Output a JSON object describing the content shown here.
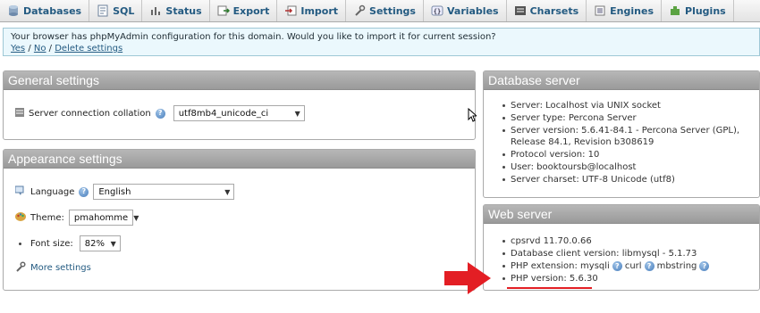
{
  "tabs": [
    {
      "label": "Databases",
      "icon": "databases-icon"
    },
    {
      "label": "SQL",
      "icon": "sql-icon"
    },
    {
      "label": "Status",
      "icon": "status-icon"
    },
    {
      "label": "Export",
      "icon": "export-icon"
    },
    {
      "label": "Import",
      "icon": "import-icon"
    },
    {
      "label": "Settings",
      "icon": "settings-icon"
    },
    {
      "label": "Variables",
      "icon": "variables-icon"
    },
    {
      "label": "Charsets",
      "icon": "charsets-icon"
    },
    {
      "label": "Engines",
      "icon": "engines-icon"
    },
    {
      "label": "Plugins",
      "icon": "plugins-icon"
    }
  ],
  "notice": {
    "text": "Your browser has phpMyAdmin configuration for this domain. Would you like to import it for current session?",
    "yes": "Yes",
    "sep1": " / ",
    "no": "No",
    "sep2": " / ",
    "delete": "Delete settings"
  },
  "general": {
    "title": "General settings",
    "collation_label": "Server connection collation",
    "collation_value": "utf8mb4_unicode_ci"
  },
  "appearance": {
    "title": "Appearance settings",
    "language_label": "Language",
    "language_value": "English",
    "theme_label": "Theme:",
    "theme_value": "pmahomme",
    "fontsize_label": "Font size:",
    "fontsize_value": "82%",
    "more_settings": "More settings"
  },
  "db_server": {
    "title": "Database server",
    "items": [
      "Server: Localhost via UNIX socket",
      "Server type: Percona Server",
      "Server version: 5.6.41-84.1 - Percona Server (GPL), Release 84.1, Revision b308619",
      "Protocol version: 10",
      "User: booktoursb@localhost",
      "Server charset: UTF-8 Unicode (utf8)"
    ]
  },
  "web_server": {
    "title": "Web server",
    "items": [
      "cpsrvd 11.70.0.66",
      "Database client version: libmysql - 5.1.73"
    ],
    "php_ext_label": "PHP extension: mysqli",
    "php_ext_curl": "curl",
    "php_ext_mbstring": "mbstring",
    "php_version": "PHP version: 5.6.30"
  },
  "colors": {
    "link": "#235a81",
    "panel_header": "#a8a8a8",
    "annotation_red": "#e31e24"
  }
}
